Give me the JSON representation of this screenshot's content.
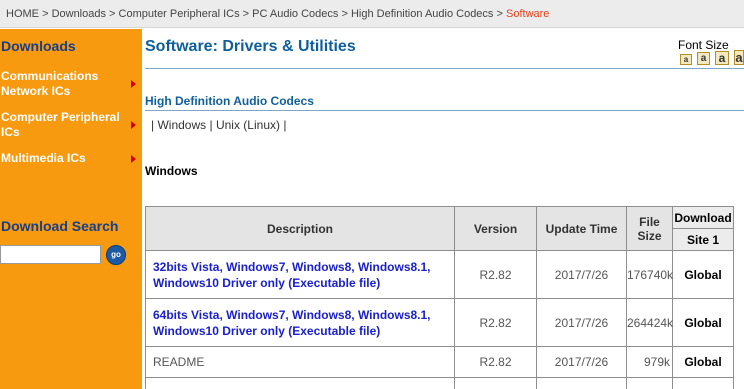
{
  "breadcrumb": {
    "items": [
      "HOME",
      "Downloads",
      "Computer Peripheral ICs",
      "PC Audio Codecs",
      "High Definition Audio Codecs"
    ],
    "separator": ">",
    "current": "Software"
  },
  "sidebar": {
    "downloads_heading": "Downloads",
    "items": [
      {
        "label": "Communications Network ICs"
      },
      {
        "label": "Computer Peripheral ICs"
      },
      {
        "label": "Multimedia ICs"
      }
    ],
    "search_heading": "Download Search",
    "search_button": "go"
  },
  "main": {
    "title": "Software: Drivers & Utilities",
    "font_size_label": "Font Size",
    "font_size_buttons": [
      "a",
      "a",
      "a",
      "a"
    ],
    "section_title": "High Definition Audio Codecs",
    "os_links": {
      "pipe": "|",
      "windows": "Windows",
      "unix": "Unix (Linux)"
    },
    "os_heading": "Windows"
  },
  "table": {
    "headers": {
      "description": "Description",
      "version": "Version",
      "update_time": "Update Time",
      "file_size": "File Size",
      "download": "Download",
      "site": "Site 1"
    },
    "rows": [
      {
        "description": "32bits Vista, Windows7, Windows8, Windows8.1, Windows10 Driver only (Executable file)",
        "version": "R2.82",
        "date": "2017/7/26",
        "size": "176740k",
        "site": "Global"
      },
      {
        "description": "64bits Vista, Windows7, Windows8, Windows8.1, Windows10 Driver only (Executable file)",
        "version": "R2.82",
        "date": "2017/7/26",
        "size": "264424k",
        "site": "Global"
      },
      {
        "description": "README",
        "version": "R2.82",
        "date": "2017/7/26",
        "size": "979k",
        "site": "Global"
      }
    ]
  },
  "colors": {
    "sidebar_bg": "#f79a0f",
    "sidebar_heading": "#153f8c",
    "title_blue": "#0f5f9c",
    "link_blue": "#1a21c8",
    "breadcrumb_current": "#e2421b"
  }
}
